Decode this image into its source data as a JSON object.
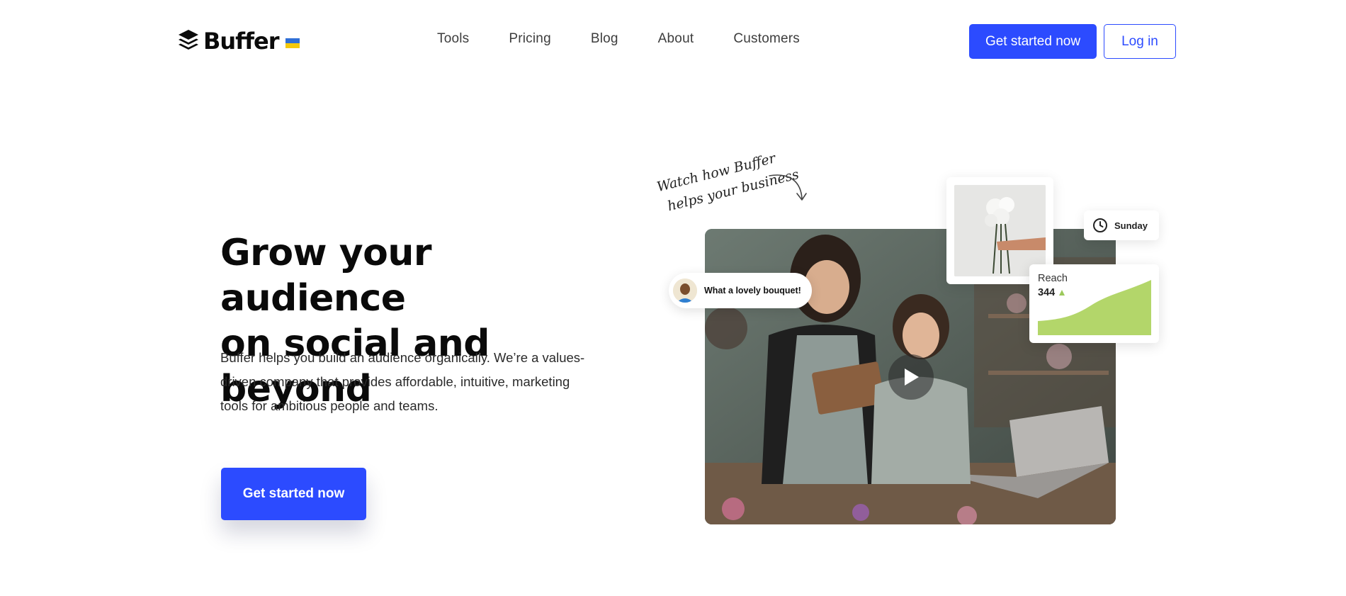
{
  "header": {
    "logo_text": "Buffer",
    "nav": [
      "Tools",
      "Pricing",
      "Blog",
      "About",
      "Customers"
    ],
    "cta_label": "Get started now",
    "login_label": "Log in"
  },
  "hero": {
    "title_line1": "Grow your audience",
    "title_line2": "on social and beyond",
    "subtitle": "Buffer helps you build an audience organically. We’re a values-driven company that provides affordable, intuitive, marketing tools for ambitious people and teams.",
    "cta_label": "Get started now"
  },
  "visual": {
    "handwritten_line1": "Watch how Buffer",
    "handwritten_line2": "helps your business",
    "comment": "What a lovely bouquet!",
    "schedule_day": "Sunday",
    "reach_label": "Reach",
    "reach_value": "344"
  },
  "colors": {
    "brand_blue": "#2c4bff",
    "chart_green": "#b3d66a"
  },
  "icons": [
    "buffer-logo-icon",
    "ukraine-flag-icon",
    "arrow-icon",
    "play-icon",
    "clock-icon",
    "trend-up-icon"
  ]
}
